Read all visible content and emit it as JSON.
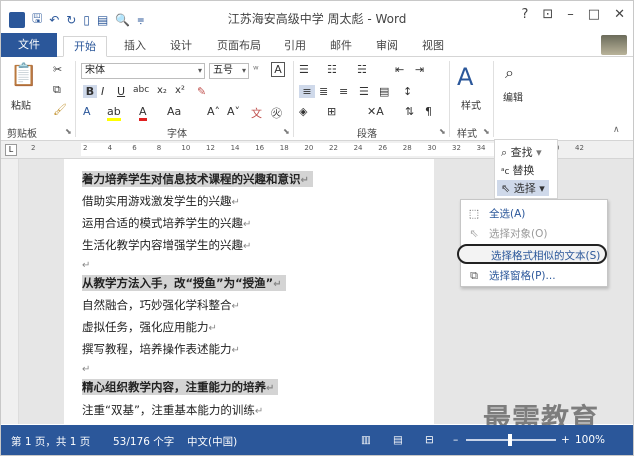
{
  "title_bar": {
    "title": "江苏海安高级中学 周太彪 - Word",
    "controls": [
      "?",
      "⊡",
      "–",
      "□",
      "✕"
    ]
  },
  "tabs": [
    "文件",
    "开始",
    "插入",
    "设计",
    "页面布局",
    "引用",
    "邮件",
    "审阅",
    "视图"
  ],
  "ribbon": {
    "paste_label": "粘贴",
    "clipboard_label": "剪贴板",
    "font_name": "宋体",
    "font_size": "五号",
    "font_group_label": "字体",
    "paragraph_label": "段落",
    "styles_label": "样式",
    "styles_group_label": "样式",
    "editing_label": "编辑"
  },
  "editing_panel": {
    "find": "查找",
    "replace": "替换",
    "select": "选择"
  },
  "select_menu": [
    {
      "label": "全选(A)",
      "disabled": false
    },
    {
      "label": "选择对象(O)",
      "disabled": true
    },
    {
      "label": "选择格式相似的文本(S)",
      "disabled": false,
      "highlighted": true
    },
    {
      "label": "选择窗格(P)...",
      "disabled": false
    }
  ],
  "ruler_ticks": [
    "2",
    "2",
    "4",
    "6",
    "8",
    "10",
    "12",
    "14",
    "16",
    "18",
    "20",
    "22",
    "24",
    "26",
    "28",
    "30",
    "32",
    "34",
    "36",
    "38",
    "40",
    "42"
  ],
  "document_lines": [
    {
      "text": "着力培养学生对信息技术课程的兴趣和意识",
      "heading": true
    },
    {
      "text": "借助实用游戏激发学生的兴趣",
      "heading": false
    },
    {
      "text": "运用合适的模式培养学生的兴趣",
      "heading": false
    },
    {
      "text": "生活化教学内容增强学生的兴趣",
      "heading": false
    },
    {
      "text": "",
      "heading": false
    },
    {
      "text": "从教学方法入手，改“授鱼”为“授渔”",
      "heading": true
    },
    {
      "text": "自然融合，巧妙强化学科整合",
      "heading": false
    },
    {
      "text": "虚拟任务，强化应用能力",
      "heading": false
    },
    {
      "text": "撰写教程，培养操作表述能力",
      "heading": false
    },
    {
      "text": "",
      "heading": false
    },
    {
      "text": "精心组织教学内容，注重能力的培养",
      "heading": true
    },
    {
      "text": "注重“双基”，注重基本能力的训练",
      "heading": false
    }
  ],
  "status_bar": {
    "page": "第 1 页，共 1 页",
    "words": "53/176 个字",
    "language": "中文(中国)",
    "zoom": "100%",
    "zoom_level": 1.0
  },
  "watermark": "最需教育",
  "colors": {
    "accent": "#2b579a",
    "highlight": "#d4d4d4"
  }
}
